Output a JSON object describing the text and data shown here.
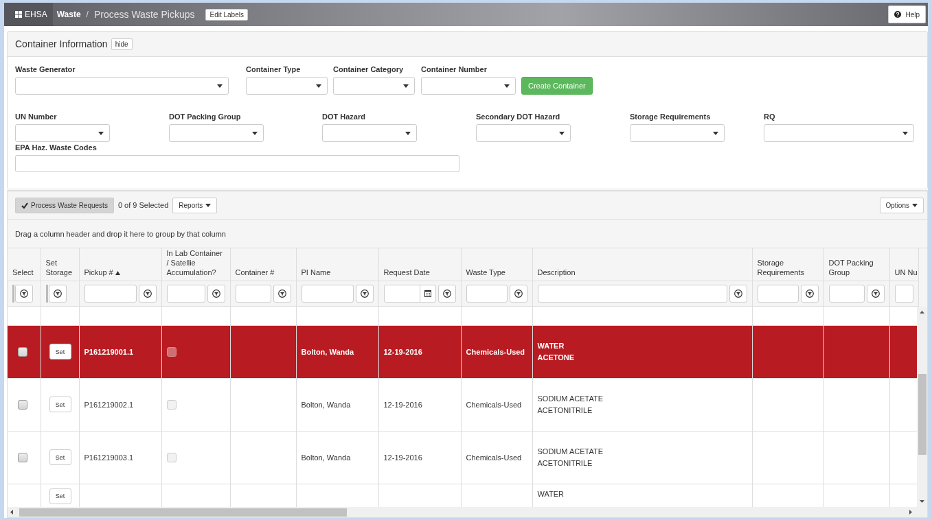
{
  "header": {
    "app": "EHSA",
    "breadcrumb": "Waste",
    "separator": "/",
    "title": "Process Waste Pickups",
    "edit_button": "Edit Labels",
    "help_button": "Help"
  },
  "container_info": {
    "title": "Container Information",
    "hide_button": "hide",
    "row1": [
      {
        "label": "Waste Generator",
        "kind": "select"
      },
      {
        "label": "Container Type",
        "kind": "select"
      },
      {
        "label": "Container Category",
        "kind": "select"
      },
      {
        "label": "Container Number",
        "kind": "select"
      }
    ],
    "create_button": "Create Container",
    "row2": [
      {
        "label": "UN Number",
        "kind": "select"
      },
      {
        "label": "DOT Packing Group",
        "kind": "select"
      },
      {
        "label": "DOT Hazard",
        "kind": "select"
      },
      {
        "label": "Secondary DOT Hazard",
        "kind": "select"
      },
      {
        "label": "Storage Requirements",
        "kind": "select"
      },
      {
        "label": "RQ",
        "kind": "select"
      }
    ],
    "row3": [
      {
        "label": "EPA Haz. Waste Codes",
        "kind": "text"
      }
    ]
  },
  "grid": {
    "process_button": "Process Waste Requests",
    "selected_count": "0 of 9 Selected",
    "reports_button": "Reports",
    "options_button": "Options",
    "group_hint": "Drag a column header and drop it here to group by that column",
    "columns": [
      {
        "label": "Select",
        "kind": "button",
        "sorted": false
      },
      {
        "label": "Set Storage",
        "kind": "button",
        "sorted": false
      },
      {
        "label": "Pickup #",
        "kind": "text",
        "sorted": true
      },
      {
        "label": "In Lab Container / Satellie Accumulation?",
        "kind": "text",
        "sorted": false
      },
      {
        "label": "Container #",
        "kind": "text",
        "sorted": false
      },
      {
        "label": "PI Name",
        "kind": "text",
        "sorted": false
      },
      {
        "label": "Request Date",
        "kind": "date",
        "sorted": false
      },
      {
        "label": "Waste Type",
        "kind": "text",
        "sorted": false
      },
      {
        "label": "Description",
        "kind": "text",
        "sorted": false
      },
      {
        "label": "Storage Requirements",
        "kind": "text",
        "sorted": false
      },
      {
        "label": "DOT Packing Group",
        "kind": "text",
        "sorted": false
      },
      {
        "label": "UN Nu",
        "kind": "input"
      }
    ],
    "rows": [
      {
        "selected": true,
        "checked": false,
        "set": "Set",
        "in_lab": false,
        "pickup": "P161219001.1",
        "pi_name": "Bolton, Wanda",
        "date": "12-19-2016",
        "waste_type": "Chemicals-Used",
        "description": [
          "WATER",
          "ACETONE"
        ]
      },
      {
        "selected": false,
        "checked": false,
        "set": "Set",
        "in_lab": false,
        "pickup": "P161219002.1",
        "pi_name": "Bolton, Wanda",
        "date": "12-19-2016",
        "waste_type": "Chemicals-Used",
        "description": [
          "SODIUM ACETATE",
          "ACETONITRILE"
        ]
      },
      {
        "selected": false,
        "checked": false,
        "set": "Set",
        "in_lab": false,
        "pickup": "P161219003.1",
        "pi_name": "Bolton, Wanda",
        "date": "12-19-2016",
        "waste_type": "Chemicals-Used",
        "description": [
          "SODIUM ACETATE",
          "ACETONITRILE"
        ]
      },
      {
        "selected": false,
        "set": "Set",
        "description": [
          "WATER"
        ]
      }
    ]
  }
}
